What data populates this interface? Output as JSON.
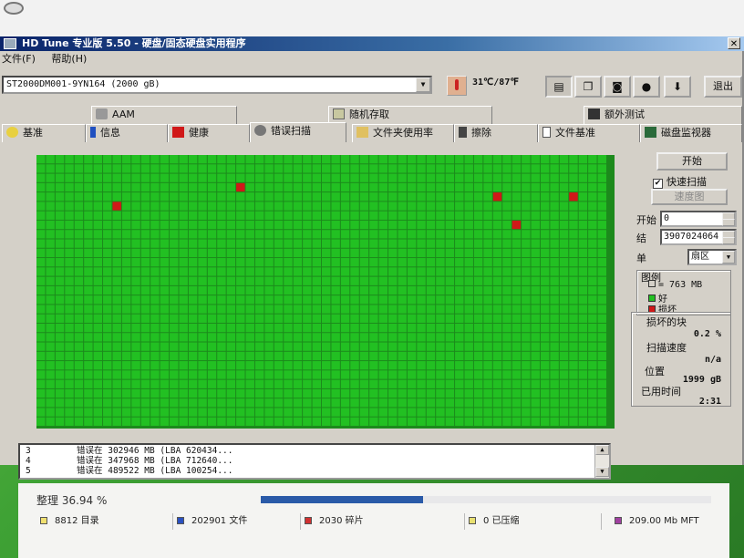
{
  "window": {
    "title": "HD Tune 专业版 5.50 - 硬盘/固态硬盘实用程序",
    "menu": [
      "文件(F)",
      "帮助(H)"
    ],
    "close_glyph": "✕"
  },
  "toolbar": {
    "drive": "ST2000DM001-9YN164 (2000 gB)",
    "temperature": "31℃/87℉",
    "exit_label": "退出",
    "icons": [
      "info-copy-icon",
      "copy-icon",
      "camera-icon",
      "coins-icon",
      "download-arrow-icon"
    ]
  },
  "tabs": {
    "row1": [
      {
        "label": "AAM",
        "icon": "speaker-icon"
      },
      {
        "label": "随机存取",
        "icon": "chart-icon"
      },
      {
        "label": "额外测试",
        "icon": "monitor-icon"
      }
    ],
    "row2": [
      {
        "label": "基准",
        "icon": "bulb-icon"
      },
      {
        "label": "信息",
        "icon": "info-icon"
      },
      {
        "label": "健康",
        "icon": "health-cross-icon"
      },
      {
        "label": "错误扫描",
        "icon": "magnifier-icon"
      },
      {
        "label": "文件夹使用率",
        "icon": "folder-icon"
      },
      {
        "label": "擦除",
        "icon": "trash-icon"
      },
      {
        "label": "文件基准",
        "icon": "file-icon"
      },
      {
        "label": "磁盘监视器",
        "icon": "disk-monitor-icon"
      }
    ],
    "active": "错误扫描"
  },
  "scan": {
    "start_button": "开始",
    "quick_scan_label": "快速扫描",
    "quick_scan_checked": true,
    "speed_map_button": "速度图",
    "start_label": "开始",
    "start_value": "0",
    "end_label": "结",
    "end_value": "3907024064",
    "unit_label": "单",
    "unit_value": "扇区",
    "legend_title": "图例",
    "legend_block": "= 763 MB",
    "legend_good": "好",
    "legend_bad": "损坏",
    "damaged_blocks_label": "损坏的块",
    "damaged_blocks_value": "0.2 %",
    "scan_speed_label": "扫描速度",
    "scan_speed_value": "n/a",
    "position_label": "位置",
    "position_value": "1999 gB",
    "elapsed_label": "已用时间",
    "elapsed_value": "2:31",
    "grid_cols": 60,
    "grid_rows": 29,
    "bad_cells": [
      {
        "col": 8,
        "row": 5
      },
      {
        "col": 21,
        "row": 3
      },
      {
        "col": 48,
        "row": 4
      },
      {
        "col": 50,
        "row": 7
      },
      {
        "col": 56,
        "row": 4
      }
    ],
    "colors": {
      "good": "#22c022",
      "bad": "#d01818",
      "grid_line": "#0b6a0b"
    }
  },
  "log": [
    {
      "num": "3",
      "text": "错误在  302946  MB  (LBA 620434..."
    },
    {
      "num": "4",
      "text": "错误在  347968  MB  (LBA 712640..."
    },
    {
      "num": "5",
      "text": "错误在  489522  MB  (LBA 100254..."
    }
  ],
  "defrag": {
    "progress_label": "整理  36.94 %",
    "progress_fraction": 0.36,
    "status": [
      {
        "text": "8812 目录",
        "color": "#f0e070"
      },
      {
        "text": "202901 文件",
        "color": "#2a50c0"
      },
      {
        "text": "2030 碎片",
        "color": "#d03030"
      },
      {
        "text": "0 已压缩",
        "color": "#e8e070"
      },
      {
        "text": "209.00 Mb MFT",
        "color": "#a040a0"
      }
    ]
  }
}
